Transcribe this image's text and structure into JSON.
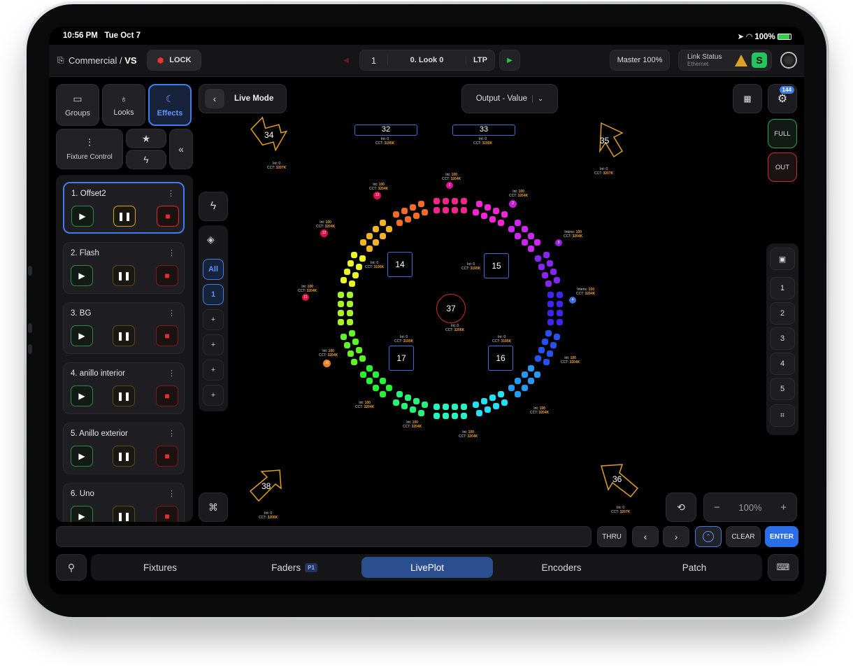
{
  "status_bar": {
    "time": "10:56 PM",
    "date": "Tue Oct 7",
    "battery": "100%"
  },
  "header": {
    "breadcrumb": "Commercial / ",
    "breadcrumb_bold": "VS",
    "lock_label": "LOCK",
    "cue_number": "1",
    "cue_name": "0. Look 0",
    "mode": "LTP",
    "master": "Master 100%",
    "link_status_title": "Link Status",
    "link_status_sub": "Ethernet",
    "link_badge": "S"
  },
  "sidebar": {
    "tabs": [
      {
        "label": "Groups"
      },
      {
        "label": "Looks"
      },
      {
        "label": "Effects"
      }
    ],
    "fixture_control": "Fixture Control",
    "effects": [
      {
        "name": "1. Offset2"
      },
      {
        "name": "2. Flash"
      },
      {
        "name": "3. BG"
      },
      {
        "name": "4. anillo interior"
      },
      {
        "name": "5. Anillo exterior"
      },
      {
        "name": "6. Uno"
      }
    ]
  },
  "liveplot": {
    "live_mode": "Live Mode",
    "output_select": "Output - Value",
    "badge_count": "144",
    "full": "FULL",
    "out": "OUT",
    "layers": {
      "all": "All",
      "one": "1",
      "add": "+"
    },
    "pages": [
      "1",
      "2",
      "3",
      "4",
      "5"
    ],
    "zoom": "100%",
    "zoom_minus": "−",
    "zoom_plus": "+",
    "rect_fixtures": [
      {
        "id": "32",
        "int": "0",
        "cct": "3195K"
      },
      {
        "id": "33",
        "int": "0",
        "cct": "3195K"
      }
    ],
    "arrows": [
      {
        "id": "34",
        "int": "0",
        "cct": "3207K"
      },
      {
        "id": "35",
        "int": "0",
        "cct": "3207K"
      },
      {
        "id": "36",
        "int": "0",
        "cct": "3207K"
      },
      {
        "id": "38",
        "int": "0",
        "cct": "3206K"
      }
    ],
    "boxes": [
      {
        "id": "14",
        "int": "0",
        "cct": "3195K"
      },
      {
        "id": "15",
        "int": "0",
        "cct": "3195K"
      },
      {
        "id": "16",
        "int": "0",
        "cct": "3195K"
      },
      {
        "id": "17",
        "int": "0",
        "cct": "3195K"
      }
    ],
    "center": {
      "id": "37",
      "int": "0",
      "cct": "3206K"
    },
    "ring_labels": [
      {
        "key": "Int",
        "int": "100",
        "cct": "3204K"
      },
      {
        "key": "Int",
        "int": "100",
        "cct": "3204K"
      },
      {
        "key": "Int",
        "int": "100",
        "cct": "3204K"
      },
      {
        "key": "Intens",
        "int": "100",
        "cct": "3204K"
      },
      {
        "key": "Intens",
        "int": "100",
        "cct": "3204K"
      },
      {
        "key": "Int",
        "int": "100",
        "cct": "3204K"
      },
      {
        "key": "Int",
        "int": "100",
        "cct": "3204K"
      },
      {
        "key": "Int",
        "int": "100",
        "cct": "3204K"
      },
      {
        "key": "Int",
        "int": "100",
        "cct": "3204K"
      },
      {
        "key": "Int",
        "int": "100",
        "cct": "3204K"
      },
      {
        "key": "Int",
        "int": "100",
        "cct": "3204K"
      },
      {
        "key": "Int",
        "int": "100",
        "cct": "3204K"
      },
      {
        "key": "Int",
        "int": "100",
        "cct": "3204K"
      }
    ],
    "ring_badges": [
      "1",
      "13",
      "2",
      "3",
      "12",
      "4",
      "11",
      "10"
    ]
  },
  "keypad": {
    "thru": "THRU",
    "clear": "CLEAR",
    "enter": "ENTER"
  },
  "tabs": [
    {
      "label": "Fixtures"
    },
    {
      "label": "Faders",
      "badge": "P1"
    },
    {
      "label": "LivePlot"
    },
    {
      "label": "Encoders"
    },
    {
      "label": "Patch"
    }
  ],
  "colors": {
    "accent": "#3f7df0",
    "play": "#2b8a47",
    "stop": "#e02b2b",
    "pause": "#d8a21c",
    "full": "#2aa44a",
    "out": "#d42a2a"
  }
}
